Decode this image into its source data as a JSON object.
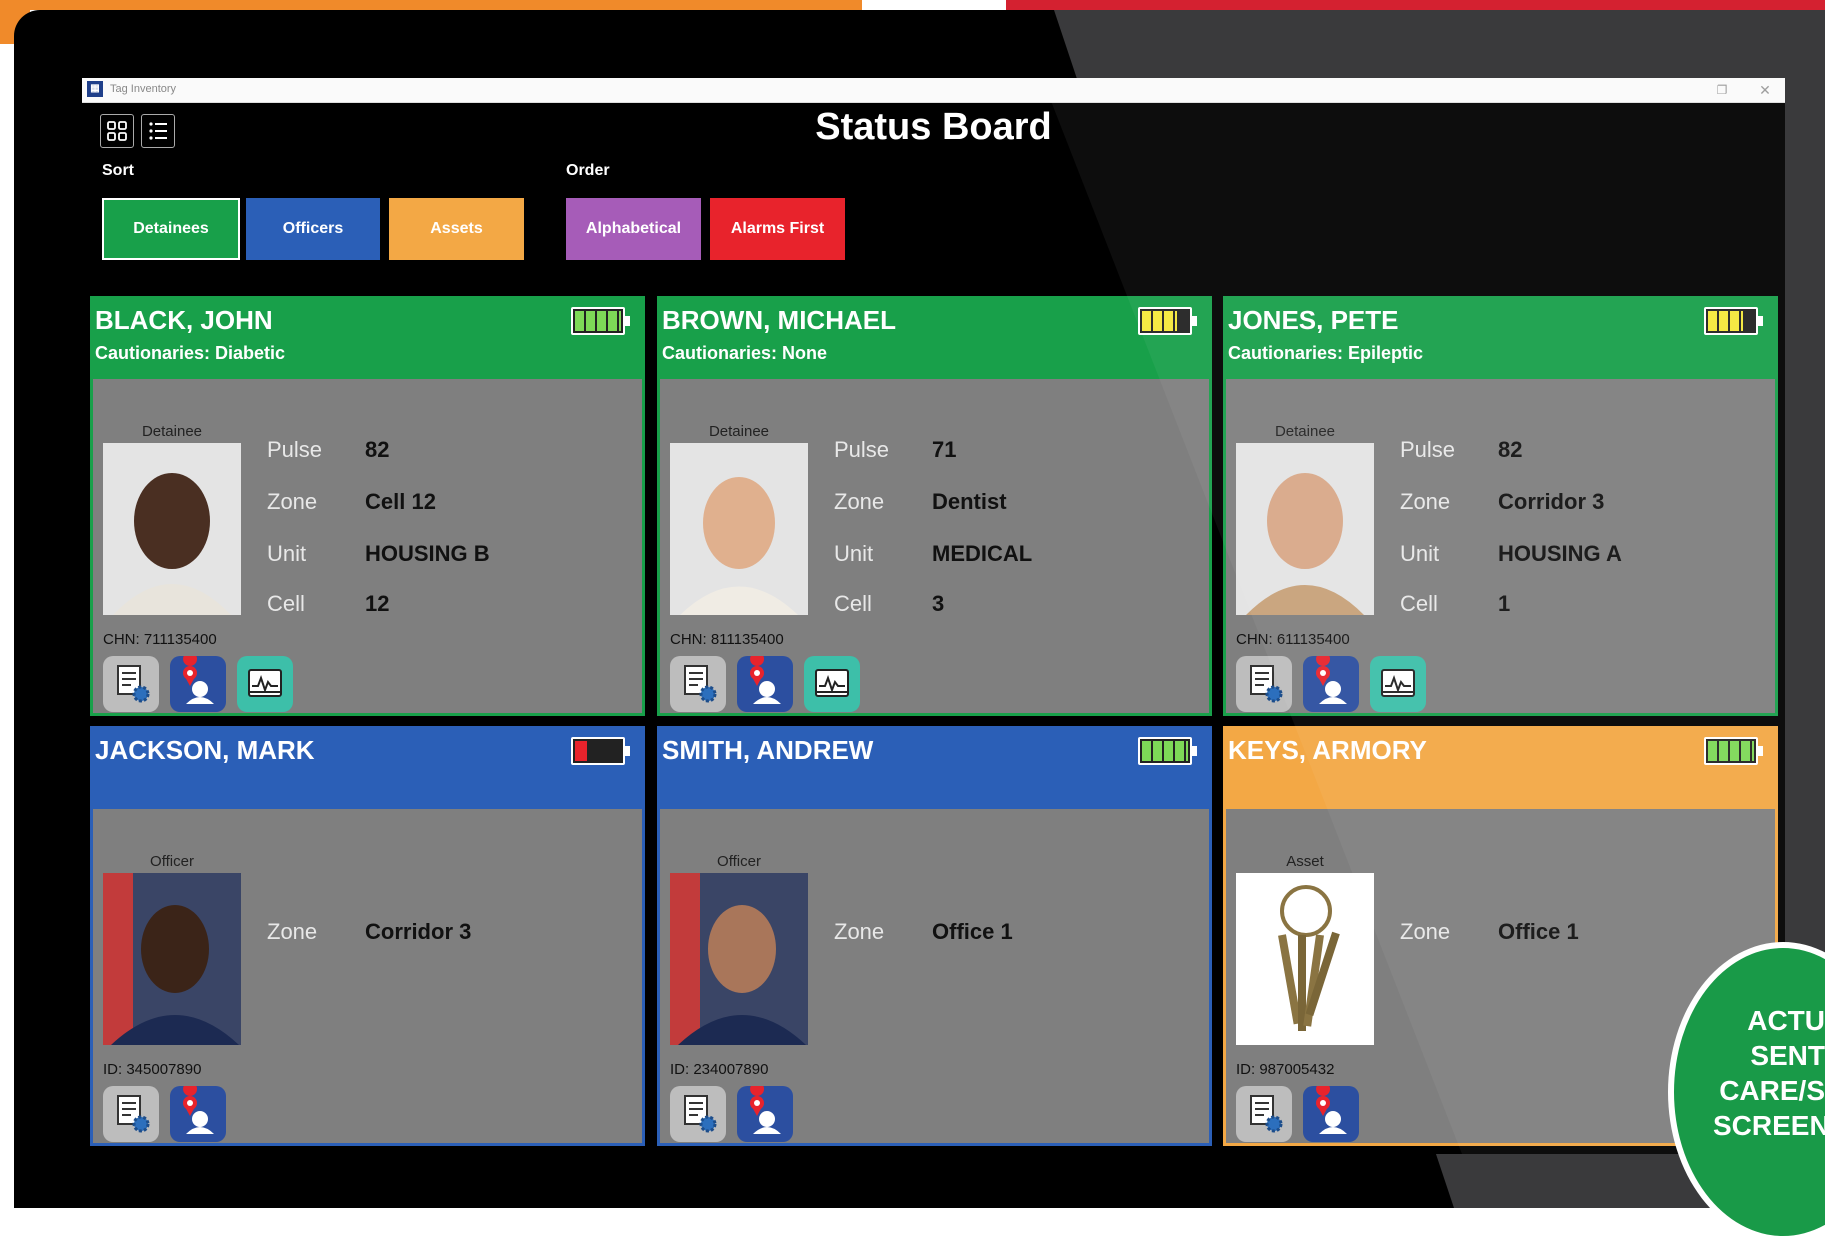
{
  "window": {
    "title": "Tag Inventory",
    "app_icon": "grid-app-icon",
    "restore_icon": "restore-icon",
    "close_icon": "close-icon"
  },
  "board": {
    "title": "Status Board"
  },
  "controls": {
    "sort_label": "Sort",
    "order_label": "Order",
    "sort_buttons": [
      "Detainees",
      "Officers",
      "Assets"
    ],
    "order_buttons": [
      "Alphabetical",
      "Alarms First"
    ]
  },
  "colors": {
    "detainee": "#18a04a",
    "officer": "#2b5fb7",
    "asset": "#f3a845",
    "alphabetical": "#a65cb8",
    "alarms": "#e8232c",
    "battery_full": "#7ed957",
    "battery_mid": "#f5e83a",
    "battery_low": "#e8232c"
  },
  "cards": [
    {
      "name": "BLACK, JOHN",
      "cautionaries": "Cautionaries: Diabetic",
      "role": "Detainee",
      "id_text": "CHN: 711135400",
      "battery": {
        "level": 1.0,
        "color": "#7ed957"
      },
      "fields": [
        {
          "label": "Pulse",
          "value": "82"
        },
        {
          "label": "Zone",
          "value": "Cell 12"
        },
        {
          "label": "Unit",
          "value": "HOUSING B"
        },
        {
          "label": "Cell",
          "value": "12"
        }
      ]
    },
    {
      "name": "BROWN, MICHAEL",
      "cautionaries": "Cautionaries: None",
      "role": "Detainee",
      "id_text": "CHN: 811135400",
      "battery": {
        "level": 0.75,
        "color": "#f5e83a"
      },
      "fields": [
        {
          "label": "Pulse",
          "value": "71"
        },
        {
          "label": "Zone",
          "value": "Dentist"
        },
        {
          "label": "Unit",
          "value": "MEDICAL"
        },
        {
          "label": "Cell",
          "value": "3"
        }
      ]
    },
    {
      "name": "JONES, PETE",
      "cautionaries": "Cautionaries: Epileptic",
      "role": "Detainee",
      "id_text": "CHN: 611135400",
      "battery": {
        "level": 0.75,
        "color": "#f5e83a"
      },
      "fields": [
        {
          "label": "Pulse",
          "value": "82"
        },
        {
          "label": "Zone",
          "value": "Corridor 3"
        },
        {
          "label": "Unit",
          "value": "HOUSING A"
        },
        {
          "label": "Cell",
          "value": "1"
        }
      ]
    },
    {
      "name": "JACKSON, MARK",
      "cautionaries": "",
      "role": "Officer",
      "id_text": "ID: 345007890",
      "battery": {
        "level": 0.25,
        "color": "#e8232c"
      },
      "fields": [
        {
          "label": "Zone",
          "value": "Corridor 3"
        }
      ]
    },
    {
      "name": "SMITH, ANDREW",
      "cautionaries": "",
      "role": "Officer",
      "id_text": "ID: 234007890",
      "battery": {
        "level": 1.0,
        "color": "#7ed957"
      },
      "fields": [
        {
          "label": "Zone",
          "value": "Office 1"
        }
      ]
    },
    {
      "name": "KEYS, ARMORY",
      "cautionaries": "",
      "role": "Asset",
      "id_text": "ID: 987005432",
      "battery": {
        "level": 1.0,
        "color": "#7ed957"
      },
      "fields": [
        {
          "label": "Zone",
          "value": "Office 1"
        }
      ]
    }
  ],
  "badge": {
    "lines": [
      "ACTU",
      "SENT",
      "CARE/S",
      "SCREEN"
    ]
  }
}
